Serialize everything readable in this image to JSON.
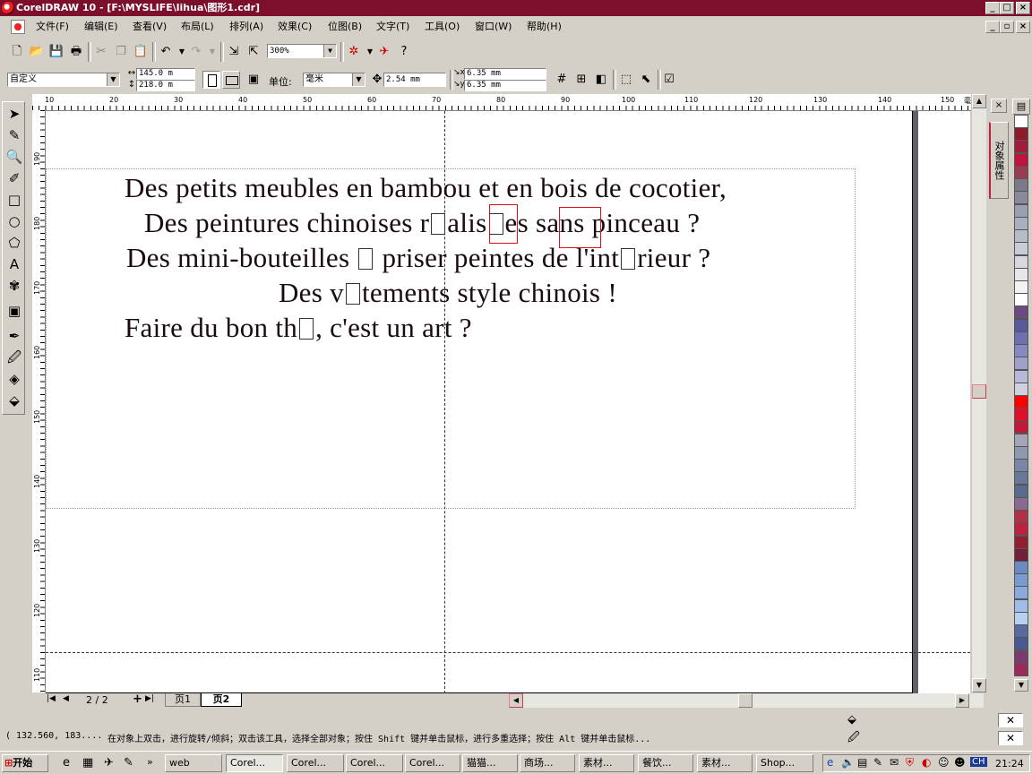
{
  "window": {
    "title": "CorelDRAW 10 - [F:\\MYSLIFE\\lihua\\图形1.cdr]",
    "title_bar_color": "#7b0f2c",
    "controls": [
      "_",
      "□",
      "×"
    ]
  },
  "menu": {
    "items": [
      "文件(F)",
      "编辑(E)",
      "查看(V)",
      "布局(L)",
      "排列(A)",
      "效果(C)",
      "位图(B)",
      "文字(T)",
      "工具(O)",
      "窗口(W)",
      "帮助(H)"
    ]
  },
  "toolbar1": {
    "zoom": "300%"
  },
  "property_bar": {
    "paper_preset": "自定义",
    "width": "145.0 m",
    "height": "218.0 m",
    "units_label": "单位:",
    "units": "毫米",
    "nudge": "2.54 mm",
    "dup_x": "6.35 mm",
    "dup_y": "6.35 mm"
  },
  "ruler": {
    "unit": "毫米",
    "h_labels": [
      "10",
      "20",
      "30",
      "40",
      "50",
      "60",
      "70",
      "80",
      "90",
      "100",
      "110",
      "120",
      "130",
      "140",
      "150"
    ],
    "v_labels": [
      "190",
      "180",
      "170",
      "160",
      "150",
      "140",
      "130",
      "120",
      "110"
    ]
  },
  "document": {
    "lines": [
      [
        "Des petits meubles en bambou et en bois de cocotier,"
      ],
      [
        "Des peintures chinoises r",
        "alis",
        "es sans pinceau ?"
      ],
      [
        "Des mini-bouteilles ",
        " priser peintes de l'int",
        "rieur ?"
      ],
      [
        "Des v",
        "tements style chinois !"
      ],
      [
        "Faire du bon th",
        ", c'est un art ?"
      ]
    ],
    "highlight_color": "#e01020"
  },
  "pages": {
    "counter": "2 / 2",
    "tabs": [
      "页1",
      "页2"
    ],
    "active": "页2"
  },
  "dockers": {
    "object_properties": "对象属性"
  },
  "status": {
    "coords": "( 132.560,  183....",
    "hint": "在对象上双击，进行旋转/倾斜；双击该工具，选择全部对象；按住 Shift 键并单击鼠标，进行多重选择；按住 Alt 键并单击鼠标..."
  },
  "taskbar": {
    "start": "开始",
    "tasks": [
      "web",
      "Corel...",
      "Corel...",
      "Corel...",
      "Corel...",
      "猫猫...",
      "商场...",
      "素材...",
      "餐饮...",
      "素材...",
      "Shop..."
    ],
    "clock": "21:24",
    "lang": "CH"
  },
  "palette": {
    "colors": [
      "#fff",
      "#8b1a2b",
      "#a01c3a",
      "#c0143c",
      "#9b3b52",
      "#7a7a8a",
      "#8a8a9a",
      "#9aa0b0",
      "#aab0c0",
      "#b8bcc8",
      "#c8ccd8",
      "#d8d8e0",
      "#e6e6ea",
      "#f4f4f4",
      "#ffffff",
      "#6a4a80",
      "#5a5a9a",
      "#7070b0",
      "#8888c0",
      "#a0a0c8",
      "#b8b8d8",
      "#d0d0e0",
      "#ff0000",
      "#e0102a",
      "#c01a3a",
      "#a5a5b5",
      "#9098b0",
      "#7a86a6",
      "#6a7898",
      "#5a6a8a",
      "#8a6a90",
      "#b0304a",
      "#c02040",
      "#902030",
      "#702038",
      "#6a8ac0",
      "#7a9ad0",
      "#8aaade",
      "#a0bce8",
      "#b8d0f0",
      "#5a6aa0",
      "#4a5a90",
      "#7a3a70",
      "#9a2a5a"
    ]
  }
}
